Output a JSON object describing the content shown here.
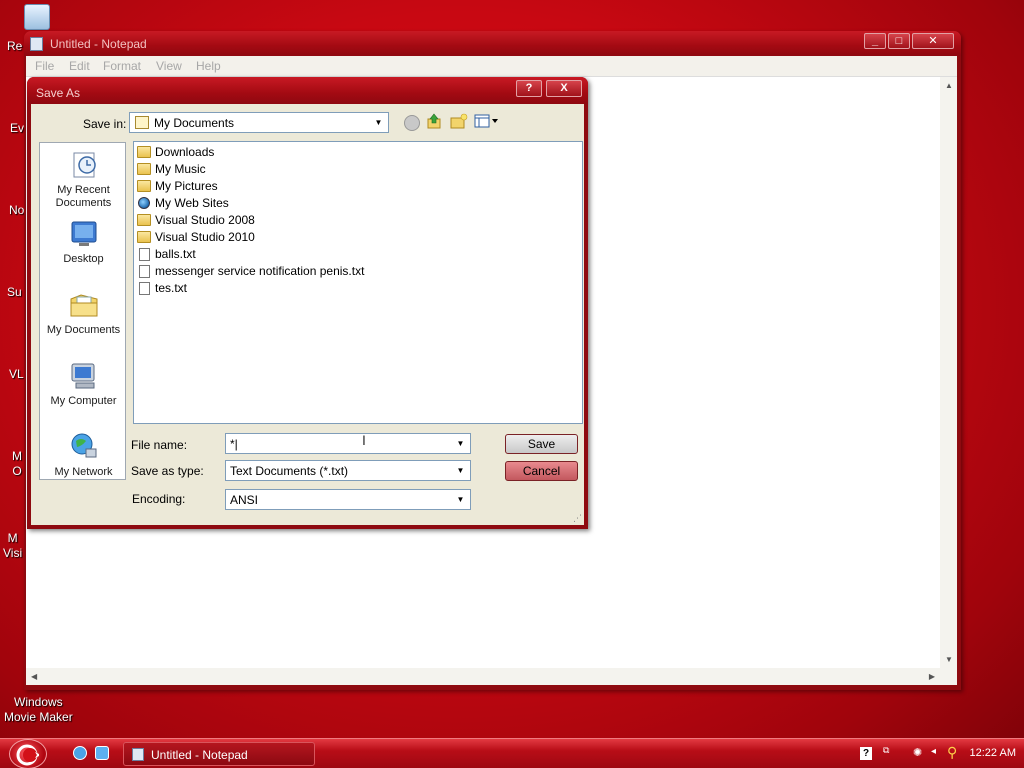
{
  "desktop": {
    "icons": [
      {
        "label": "Re"
      },
      {
        "label": "Ev"
      },
      {
        "label": "No"
      },
      {
        "label": "Su"
      },
      {
        "label": "VL"
      },
      {
        "label": "M\nO"
      },
      {
        "label": "M\nVisi"
      },
      {
        "label": "Windows\nMovie Maker"
      }
    ]
  },
  "notepad": {
    "title": "Untitled - Notepad",
    "menu": [
      "File",
      "Edit",
      "Format",
      "View",
      "Help"
    ],
    "caption_buttons": [
      "minimize",
      "maximize",
      "close"
    ]
  },
  "dialog": {
    "title": "Save As",
    "help_button": "?",
    "close_button": "X",
    "save_in_label": "Save in:",
    "save_in_value": "My Documents",
    "toolbar_icons": [
      "back-icon",
      "up-folder-icon",
      "new-folder-icon",
      "views-menu-icon"
    ],
    "places": [
      {
        "label": "My Recent\nDocuments",
        "icon": "recent-documents-icon"
      },
      {
        "label": "Desktop",
        "icon": "desktop-icon"
      },
      {
        "label": "My Documents",
        "icon": "my-documents-icon"
      },
      {
        "label": "My Computer",
        "icon": "my-computer-icon"
      },
      {
        "label": "My Network",
        "icon": "my-network-icon"
      }
    ],
    "files": [
      {
        "name": "Downloads",
        "type": "folder"
      },
      {
        "name": "My Music",
        "type": "folder"
      },
      {
        "name": "My Pictures",
        "type": "folder"
      },
      {
        "name": "My Web Sites",
        "type": "web"
      },
      {
        "name": "Visual Studio 2008",
        "type": "folder"
      },
      {
        "name": "Visual Studio 2010",
        "type": "folder"
      },
      {
        "name": "balls.txt",
        "type": "txt"
      },
      {
        "name": "messenger service notification penis.txt",
        "type": "txt"
      },
      {
        "name": "tes.txt",
        "type": "txt"
      }
    ],
    "file_name_label": "File name:",
    "file_name_value": "*|",
    "save_as_type_label": "Save as type:",
    "save_as_type_value": "Text Documents (*.txt)",
    "encoding_label": "Encoding:",
    "encoding_value": "ANSI",
    "save_button": "Save",
    "cancel_button": "Cancel"
  },
  "taskbar": {
    "task_label": "Untitled - Notepad",
    "clock": "12:22 AM"
  },
  "colors": {
    "desktop": "#c80812",
    "titlebar": "#a30a12",
    "dialog_face": "#ece9d8"
  }
}
